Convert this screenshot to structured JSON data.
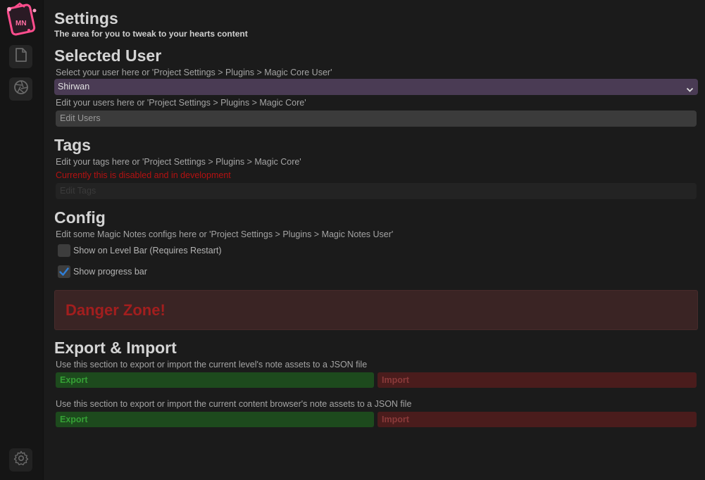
{
  "sidebar": {
    "logo_text": "MN",
    "items": [
      {
        "icon": "document-icon"
      },
      {
        "icon": "aperture-icon"
      }
    ],
    "bottom_icon": "gear-icon"
  },
  "header": {
    "title": "Settings",
    "subtitle": "The area for you to tweak to your hearts content"
  },
  "selected_user": {
    "heading": "Selected User",
    "hint": "Select your user here or 'Project Settings > Plugins > Magic Core User'",
    "selected_value": "Shirwan",
    "edit_hint": "Edit your users here or 'Project Settings > Plugins > Magic Core'",
    "edit_button": "Edit Users"
  },
  "tags": {
    "heading": "Tags",
    "hint": "Edit your tags here or 'Project Settings > Plugins > Magic Core'",
    "warning": "Currently this is disabled and in development",
    "edit_button": "Edit Tags"
  },
  "config": {
    "heading": "Config",
    "hint": "Edit some Magic Notes configs here or 'Project Settings > Plugins > Magic Notes User'",
    "options": [
      {
        "label": "Show on Level Bar (Requires Restart)",
        "checked": false
      },
      {
        "label": "Show progress bar",
        "checked": true
      }
    ]
  },
  "danger_zone": {
    "title": "Danger Zone!"
  },
  "export_import": {
    "heading": "Export & Import",
    "sections": [
      {
        "hint": "Use this section to export or import the current level's note assets to a JSON file",
        "export_label": "Export",
        "import_label": "Import"
      },
      {
        "hint": "Use this section to export or import the current content browser's note assets to a JSON file",
        "export_label": "Export",
        "import_label": "Import"
      }
    ]
  },
  "colors": {
    "background": "#1b1b1b",
    "dropdown": "#4a3b54",
    "danger_text": "#a21e1e",
    "export_bg": "#1d4a1d",
    "import_bg": "#4a1c1c",
    "warning_text": "#b51111",
    "check_accent": "#2f7fd8"
  }
}
